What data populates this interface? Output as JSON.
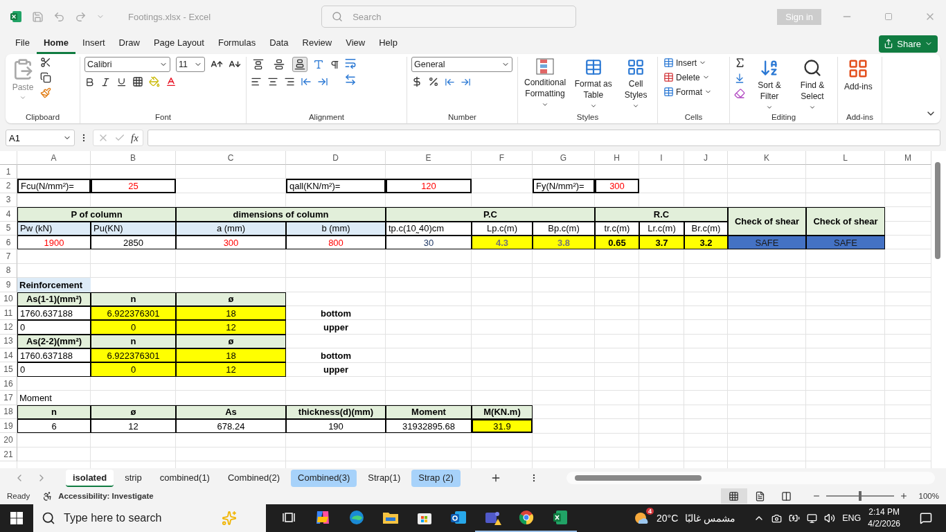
{
  "window": {
    "title": "Footings.xlsx  -  Excel",
    "search_placeholder": "Search",
    "sign_in": "Sign in"
  },
  "menu": {
    "tabs": [
      {
        "label": "File",
        "selected": false
      },
      {
        "label": "Home",
        "selected": true
      },
      {
        "label": "Insert",
        "selected": false
      },
      {
        "label": "Draw",
        "selected": false
      },
      {
        "label": "Page Layout",
        "selected": false
      },
      {
        "label": "Formulas",
        "selected": false
      },
      {
        "label": "Data",
        "selected": false
      },
      {
        "label": "Review",
        "selected": false
      },
      {
        "label": "View",
        "selected": false
      },
      {
        "label": "Help",
        "selected": false
      }
    ],
    "share": "Share"
  },
  "ribbon": {
    "clipboard": {
      "label": "Clipboard",
      "paste": "Paste"
    },
    "font": {
      "label": "Font",
      "family": "Calibri",
      "size": "11"
    },
    "alignment": {
      "label": "Alignment",
      "vertical": [
        {
          "selected": false
        },
        {
          "selected": false
        },
        {
          "selected": true
        }
      ]
    },
    "number": {
      "label": "Number",
      "format": "General"
    },
    "styles": {
      "label": "Styles",
      "buttons": [
        "Conditional Formatting",
        "Format as Table",
        "Cell Styles"
      ]
    },
    "cells": {
      "label": "Cells",
      "buttons": [
        "Insert",
        "Delete",
        "Format"
      ]
    },
    "editing": {
      "label": "Editing",
      "buttons": [
        "Sort & Filter",
        "Find & Select"
      ]
    },
    "addins": {
      "label": "Add-ins",
      "button": "Add-ins"
    }
  },
  "formula_bar": {
    "name_box": "A1",
    "fx": "fx"
  },
  "sheet": {
    "columns": [
      "A",
      "B",
      "C",
      "D",
      "E",
      "F",
      "G",
      "H",
      "I",
      "J",
      "K",
      "L",
      "M"
    ],
    "rows": [
      {
        "number": "1"
      },
      {
        "number": "2",
        "cells": [
          {
            "kind": "label-box",
            "text": "Fcu(N/mm²)="
          },
          {
            "kind": "input-box",
            "text": "25"
          },
          {
            "kind": "blank"
          },
          {
            "kind": "label-box",
            "text": "qall(KN/m²)="
          },
          {
            "kind": "input-box",
            "text": "120"
          },
          {
            "kind": "blank"
          },
          {
            "kind": "label-box",
            "text": "Fy(N/mm²)="
          },
          {
            "kind": "input-box",
            "text": "300"
          }
        ]
      },
      {
        "number": "3"
      },
      {
        "number": "4",
        "cells": [
          {
            "kind": "group-head",
            "text": "P of column"
          },
          {
            "kind": "merged-left"
          },
          {
            "kind": "group-head",
            "text": "dimensions of column"
          },
          {
            "kind": "merged-left"
          },
          {
            "kind": "group-head",
            "text": "P.C"
          },
          {
            "kind": "merged-left"
          },
          {
            "kind": "merged-left"
          },
          {
            "kind": "group-head",
            "text": "R.C"
          },
          {
            "kind": "merged-left"
          },
          {
            "kind": "merged-left"
          },
          {
            "kind": "group-head",
            "text": "Check of shear"
          },
          {
            "kind": "group-head",
            "text": "Check of shear"
          }
        ]
      },
      {
        "number": "5",
        "cells": [
          {
            "kind": "sub-head-left",
            "text": "Pw (kN)"
          },
          {
            "kind": "sub-head-left",
            "text": "Pu(KN)"
          },
          {
            "kind": "sub-head",
            "text": "a (mm)"
          },
          {
            "kind": "sub-head",
            "text": "b (mm)"
          },
          {
            "kind": "field-head-left",
            "text": "tp.c(10˷40)cm"
          },
          {
            "kind": "field-head",
            "text": "Lp.c(m)"
          },
          {
            "kind": "field-head",
            "text": "Bp.c(m)"
          },
          {
            "kind": "field-head",
            "text": "tr.c(m)"
          },
          {
            "kind": "field-head",
            "text": "Lr.c(m)"
          },
          {
            "kind": "field-head",
            "text": "Br.c(m)"
          },
          {
            "kind": "merged-up"
          },
          {
            "kind": "merged-up"
          }
        ]
      },
      {
        "number": "6",
        "cells": [
          {
            "kind": "value-red",
            "text": "1900"
          },
          {
            "kind": "value",
            "text": "2850"
          },
          {
            "kind": "value-red",
            "text": "300"
          },
          {
            "kind": "value-red",
            "text": "800"
          },
          {
            "kind": "value-navy",
            "text": "30"
          },
          {
            "kind": "yellow-dim",
            "text": "4.3"
          },
          {
            "kind": "yellow-dim",
            "text": "3.8"
          },
          {
            "kind": "yellow-bold",
            "text": "0.65"
          },
          {
            "kind": "yellow-bold",
            "text": "3.7"
          },
          {
            "kind": "yellow-bold",
            "text": "3.2"
          },
          {
            "kind": "status",
            "text": "SAFE"
          },
          {
            "kind": "status",
            "text": "SAFE"
          }
        ]
      },
      {
        "number": "7"
      },
      {
        "number": "8"
      },
      {
        "number": "9",
        "cells": [
          {
            "kind": "note",
            "text": "Reinforcement"
          }
        ]
      },
      {
        "number": "10",
        "cells": [
          {
            "kind": "group-head",
            "text": "As(1-1)(mm²)"
          },
          {
            "kind": "group-head",
            "text": "n"
          },
          {
            "kind": "group-head",
            "text": "ø"
          }
        ]
      },
      {
        "number": "11",
        "cells": [
          {
            "kind": "value-left",
            "text": "1760.637188"
          },
          {
            "kind": "yellow",
            "text": "6.922376301"
          },
          {
            "kind": "yellow",
            "text": "18"
          },
          {
            "kind": "bold-text",
            "text": "bottom"
          }
        ]
      },
      {
        "number": "12",
        "cells": [
          {
            "kind": "value-left",
            "text": "0"
          },
          {
            "kind": "yellow",
            "text": "0"
          },
          {
            "kind": "yellow",
            "text": "12"
          },
          {
            "kind": "bold-text",
            "text": "upper"
          }
        ]
      },
      {
        "number": "13",
        "cells": [
          {
            "kind": "group-head",
            "text": "As(2-2)(mm²)"
          },
          {
            "kind": "group-head",
            "text": "n"
          },
          {
            "kind": "group-head",
            "text": "ø"
          }
        ]
      },
      {
        "number": "14",
        "cells": [
          {
            "kind": "value-left",
            "text": "1760.637188"
          },
          {
            "kind": "yellow",
            "text": "6.922376301"
          },
          {
            "kind": "yellow",
            "text": "18"
          },
          {
            "kind": "bold-text",
            "text": "bottom"
          }
        ]
      },
      {
        "number": "15",
        "cells": [
          {
            "kind": "value-left",
            "text": "0"
          },
          {
            "kind": "yellow",
            "text": "0"
          },
          {
            "kind": "yellow",
            "text": "12"
          },
          {
            "kind": "bold-text",
            "text": "upper"
          }
        ]
      },
      {
        "number": "16"
      },
      {
        "number": "17",
        "cells": [
          {
            "kind": "text",
            "text": "Moment"
          }
        ]
      },
      {
        "number": "18",
        "cells": [
          {
            "kind": "group-head",
            "text": "n"
          },
          {
            "kind": "group-head",
            "text": "ø"
          },
          {
            "kind": "group-head",
            "text": "As"
          },
          {
            "kind": "group-head",
            "text": "thickness(d)(mm)"
          },
          {
            "kind": "group-head",
            "text": "Moment"
          },
          {
            "kind": "group-head",
            "text": "M(KN.m)"
          }
        ]
      },
      {
        "number": "19",
        "cells": [
          {
            "kind": "value",
            "text": "6"
          },
          {
            "kind": "value",
            "text": "12"
          },
          {
            "kind": "value",
            "text": "678.24"
          },
          {
            "kind": "value",
            "text": "190"
          },
          {
            "kind": "value",
            "text": "31932895.68"
          },
          {
            "kind": "yellow-box",
            "text": "31.9"
          }
        ]
      },
      {
        "number": "20"
      },
      {
        "number": "21"
      }
    ]
  },
  "sheet_tabs": [
    {
      "label": "isolated",
      "selected": true,
      "highlighted": false
    },
    {
      "label": "strip",
      "selected": false,
      "highlighted": false
    },
    {
      "label": "combined(1)",
      "selected": false,
      "highlighted": false
    },
    {
      "label": "Combined(2)",
      "selected": false,
      "highlighted": false
    },
    {
      "label": "Combined(3)",
      "selected": false,
      "highlighted": true
    },
    {
      "label": "Strap(1)",
      "selected": false,
      "highlighted": false
    },
    {
      "label": "Strap (2)",
      "selected": false,
      "highlighted": true
    }
  ],
  "status_bar": {
    "ready": "Ready",
    "accessibility": "Accessibility: Investigate",
    "views": [
      {
        "kind": "normal",
        "selected": true
      },
      {
        "kind": "page-layout",
        "selected": false
      },
      {
        "kind": "page-break",
        "selected": false
      }
    ],
    "zoom": {
      "level": 0.5,
      "reading": "100%"
    }
  },
  "taskbar": {
    "search_placeholder": "Type here to search",
    "apps": [
      {
        "kind": "task-view",
        "running": false
      },
      {
        "kind": "copilot",
        "running": false
      },
      {
        "kind": "edge",
        "running": false
      },
      {
        "kind": "explorer",
        "running": false
      },
      {
        "kind": "store",
        "running": false
      },
      {
        "kind": "outlook",
        "running": false
      },
      {
        "kind": "teams",
        "running": true
      },
      {
        "kind": "chrome",
        "running": true
      },
      {
        "kind": "excel",
        "running": true
      }
    ],
    "weather": {
      "badge": "4",
      "temperature": "20°C",
      "condition": "مشمس غالبًا"
    },
    "language": "ENG",
    "time": "2:14 PM",
    "date": "4/2/2026"
  }
}
